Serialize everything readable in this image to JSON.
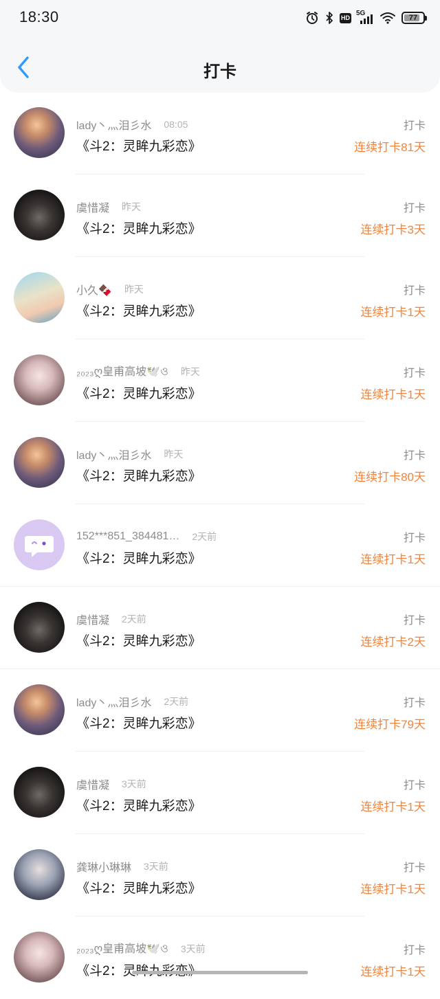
{
  "status_bar": {
    "time": "18:30",
    "network": "5G",
    "hd_badge": "HD",
    "battery": "77",
    "icons": [
      "alarm-icon",
      "bluetooth-icon",
      "hd-icon",
      "5g-signal-icon",
      "wifi-icon",
      "battery-icon"
    ]
  },
  "nav": {
    "back_icon": "chevron-left-icon",
    "title": "打卡"
  },
  "colors": {
    "accent": "#2f9bff",
    "streak": "#f0843c",
    "muted_text": "#8c8c8c",
    "header_bg": "#f6f7f9"
  },
  "items": [
    {
      "user": "lady丶灬泪彡水",
      "time": "08:05",
      "book": "《斗2：灵眸九彩恋》",
      "action": "打卡",
      "streak": "连续打卡81天",
      "avatar": "avatar-sunset-anime"
    },
    {
      "user": "虞惜凝",
      "time": "昨天",
      "book": "《斗2：灵眸九彩恋》",
      "action": "打卡",
      "streak": "连续打卡3天",
      "avatar": "avatar-dark-anime"
    },
    {
      "user": "小久🍫",
      "time": "昨天",
      "book": "《斗2：灵眸九彩恋》",
      "action": "打卡",
      "streak": "连续打卡1天",
      "avatar": "avatar-beach-girl"
    },
    {
      "user": "₂₀₂₃ღ皇甫高坡🕊️ও",
      "time": "昨天",
      "book": "《斗2：灵眸九彩恋》",
      "action": "打卡",
      "streak": "连续打卡1天",
      "avatar": "avatar-anime-girl"
    },
    {
      "user": "lady丶灬泪彡水",
      "time": "昨天",
      "book": "《斗2：灵眸九彩恋》",
      "action": "打卡",
      "streak": "连续打卡80天",
      "avatar": "avatar-sunset-anime"
    },
    {
      "user": "152***851_384481…",
      "time": "2天前",
      "book": "《斗2：灵眸九彩恋》",
      "action": "打卡",
      "streak": "连续打卡1天",
      "avatar": "avatar-default-chat"
    },
    {
      "user": "虞惜凝",
      "time": "2天前",
      "book": "《斗2：灵眸九彩恋》",
      "action": "打卡",
      "streak": "连续打卡2天",
      "avatar": "avatar-dark-anime"
    },
    {
      "user": "lady丶灬泪彡水",
      "time": "2天前",
      "book": "《斗2：灵眸九彩恋》",
      "action": "打卡",
      "streak": "连续打卡79天",
      "avatar": "avatar-sunset-anime"
    },
    {
      "user": "虞惜凝",
      "time": "3天前",
      "book": "《斗2：灵眸九彩恋》",
      "action": "打卡",
      "streak": "连续打卡1天",
      "avatar": "avatar-dark-anime"
    },
    {
      "user": "龚琳小琳琳",
      "time": "3天前",
      "book": "《斗2：灵眸九彩恋》",
      "action": "打卡",
      "streak": "连续打卡1天",
      "avatar": "avatar-boy"
    },
    {
      "user": "₂₀₂₃ღ皇甫高坡🕊️ও",
      "time": "3天前",
      "book": "《斗2：灵眸九彩恋》",
      "action": "打卡",
      "streak": "连续打卡1天",
      "avatar": "avatar-anime-girl"
    }
  ]
}
